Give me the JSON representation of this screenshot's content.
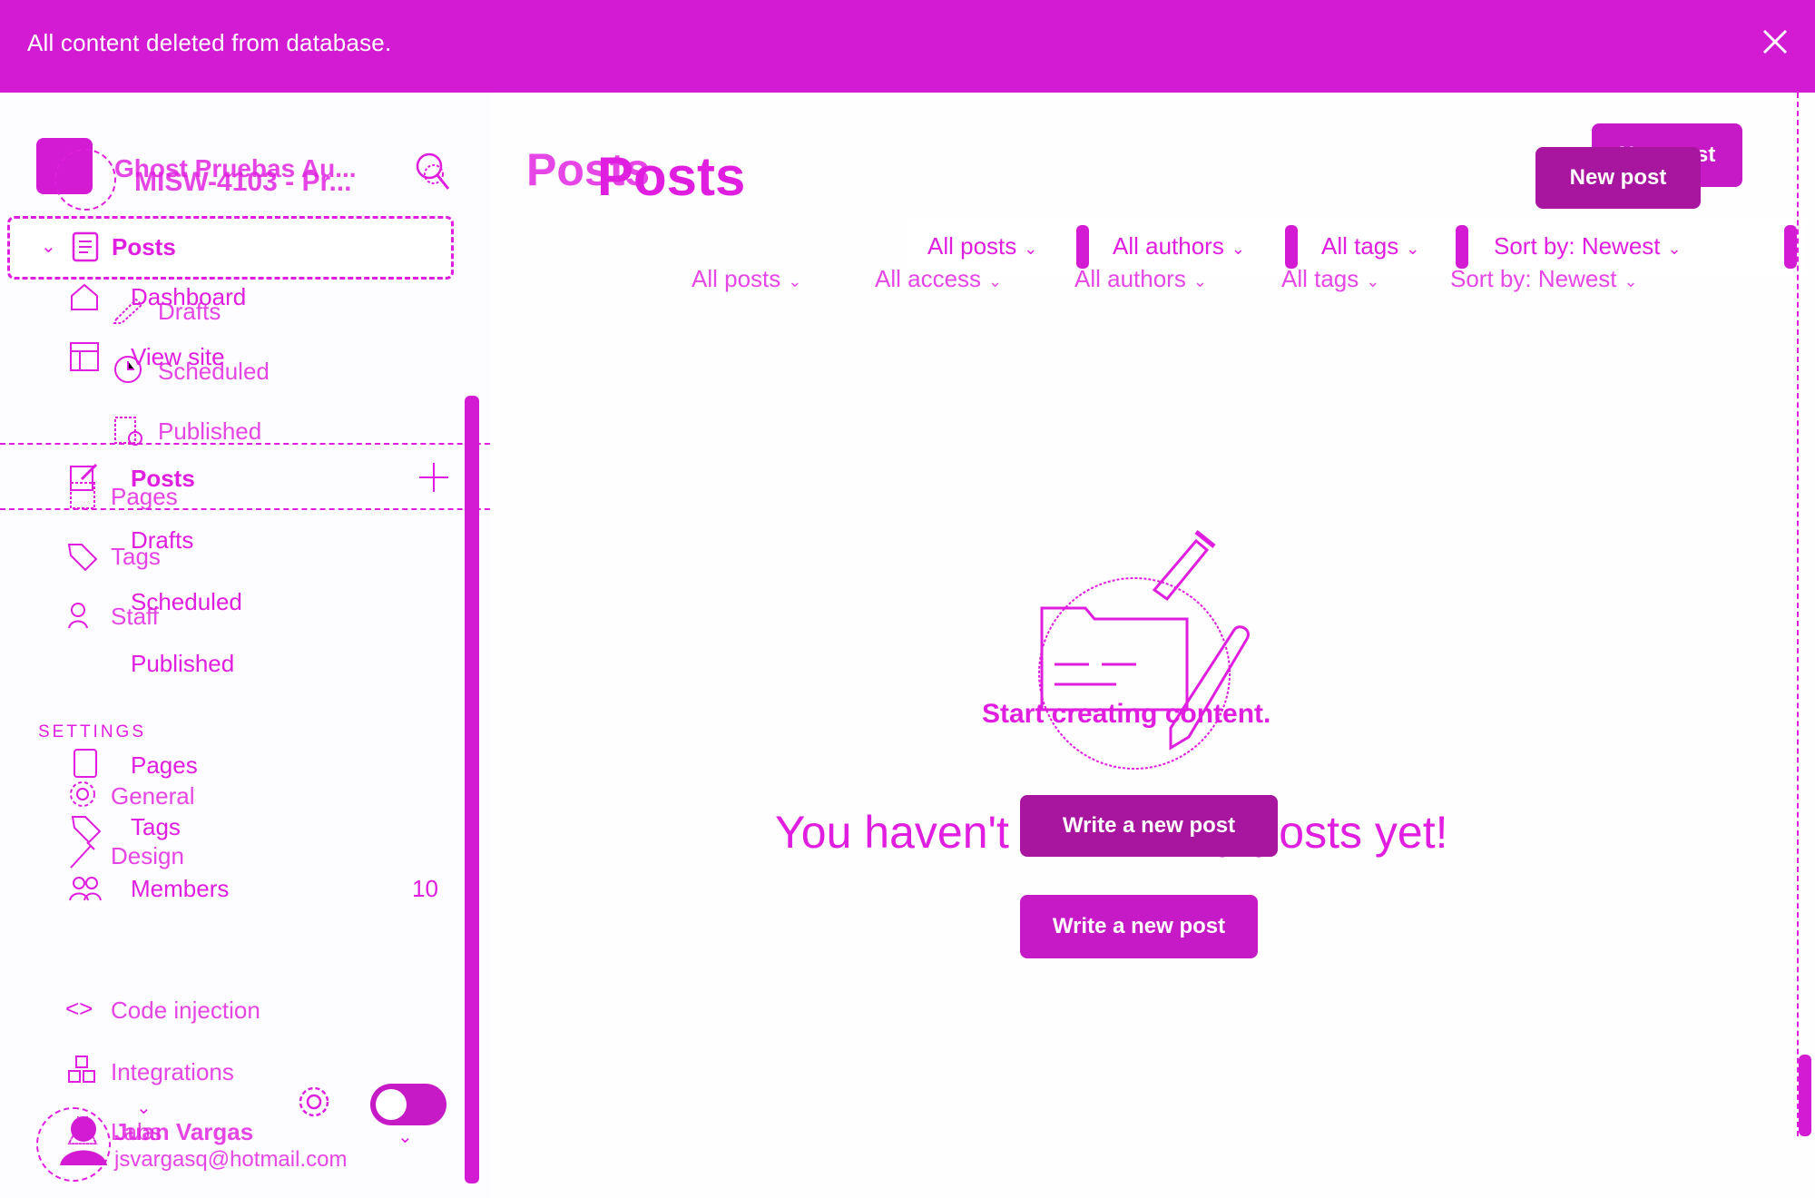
{
  "banner": {
    "message": "All content deleted from database."
  },
  "sidebar": {
    "site_title_a": "Ghost Pruebas Au...",
    "site_title_b": "MISW-4103 - Pr...",
    "active_item": "Posts",
    "nav_a": [
      "Dashboard",
      "View site",
      "Posts",
      "Drafts",
      "Scheduled",
      "Published"
    ],
    "nav_b": [
      "Drafts",
      "Scheduled",
      "Published",
      "Pages",
      "Tags",
      "Staff"
    ],
    "manage_items": [
      "Pages",
      "Tags",
      "Members"
    ],
    "members_count": "10",
    "settings_heading": "SETTINGS",
    "settings_items": [
      "General",
      "Design",
      "Code injection",
      "Integrations",
      "Labs"
    ],
    "user": {
      "name": "Juan Vargas",
      "email": "jsvargasq@hotmail.com"
    }
  },
  "main": {
    "title_a": "Posts",
    "title_b": "Posts",
    "new_post_a": "New post",
    "new_post_b": "New post",
    "filters_a": [
      "All posts",
      "All authors",
      "All tags",
      "Sort by: Newest"
    ],
    "filters_b": [
      "All posts",
      "All access",
      "All authors",
      "All tags",
      "Sort by: Newest"
    ],
    "empty_title_a": "Start creating content.",
    "empty_title_b": "You haven't written any posts yet!",
    "empty_button_a": "Write a new post",
    "empty_button_b": "Write a new post"
  },
  "colors": {
    "accent": "#d21bd2",
    "text": "#e01ee0",
    "background": "#fdfcfe"
  }
}
